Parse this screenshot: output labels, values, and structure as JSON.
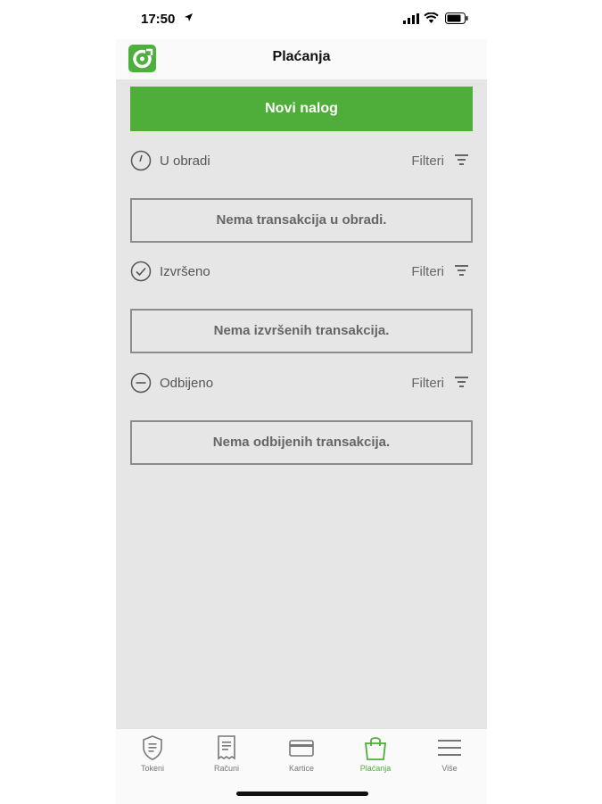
{
  "status_bar": {
    "time": "17:50"
  },
  "header": {
    "title": "Plaćanja"
  },
  "actions": {
    "new_order_label": "Novi nalog"
  },
  "sections": [
    {
      "label": "U obradi",
      "filter_label": "Filteri",
      "empty_text": "Nema transakcija u obradi.",
      "icon": "clock-icon"
    },
    {
      "label": "Izvršeno",
      "filter_label": "Filteri",
      "empty_text": "Nema izvršenih transakcija.",
      "icon": "check-circle-icon"
    },
    {
      "label": "Odbijeno",
      "filter_label": "Filteri",
      "empty_text": "Nema odbijenih transakcija.",
      "icon": "minus-circle-icon"
    }
  ],
  "tabbar": {
    "items": [
      {
        "label": "Tokeni",
        "icon": "shield-icon",
        "active": false
      },
      {
        "label": "Računi",
        "icon": "receipt-icon",
        "active": false
      },
      {
        "label": "Kartice",
        "icon": "card-icon",
        "active": false
      },
      {
        "label": "Plaćanja",
        "icon": "bag-icon",
        "active": true
      },
      {
        "label": "Više",
        "icon": "menu-icon",
        "active": false
      }
    ]
  },
  "colors": {
    "brand": "#4fae3a",
    "content_bg": "#e6e6e6"
  }
}
